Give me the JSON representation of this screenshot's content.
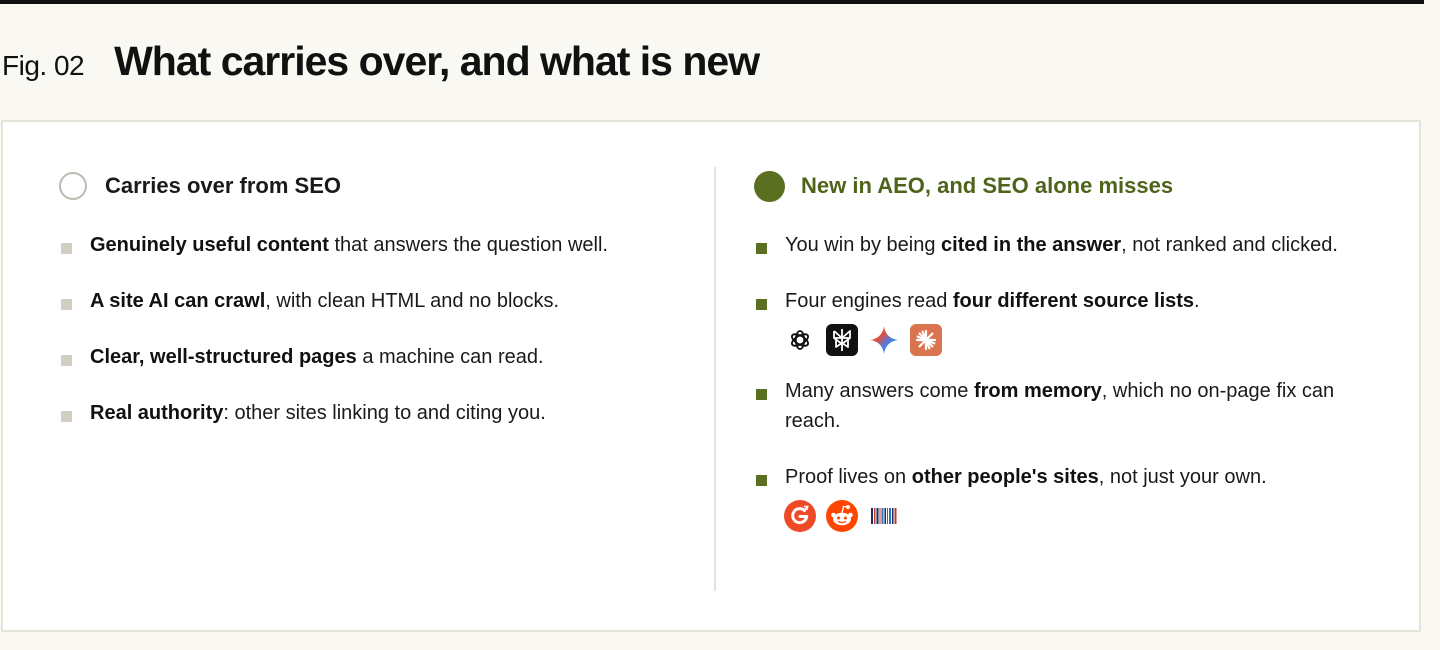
{
  "figure": {
    "label": "Fig. 02",
    "title": "What carries over, and what is new"
  },
  "left": {
    "title": "Carries over from SEO",
    "items": [
      {
        "strong": "Genuinely useful content",
        "rest": " that answers the question well."
      },
      {
        "strong": "A site AI can crawl",
        "rest": ", with clean HTML and no blocks."
      },
      {
        "strong": "Clear, well-structured pages",
        "rest": " a machine can read."
      },
      {
        "strong": "Real authority",
        "rest": ": other sites linking to and citing you."
      }
    ]
  },
  "right": {
    "title": "New in AEO, and SEO alone misses",
    "items": [
      {
        "pre": "You win by being ",
        "strong": "cited in the answer",
        "post": ", not ranked and clicked."
      },
      {
        "pre": "Four engines read ",
        "strong": "four different source lists",
        "post": ".",
        "icons": [
          "openai-icon",
          "perplexity-icon",
          "gemini-icon",
          "claude-icon"
        ]
      },
      {
        "pre": "Many answers come ",
        "strong": "from memory",
        "post": ", which no on-page fix can reach."
      },
      {
        "pre": "Proof lives on ",
        "strong": "other people's sites",
        "post": ", not just your own.",
        "icons": [
          "g2-icon",
          "reddit-icon",
          "wikipedia-barcode-icon"
        ]
      }
    ]
  },
  "colors": {
    "accent_green": "#5a6f1f",
    "heading_green": "#4f641b",
    "bullet_grey": "#d3cec2",
    "background": "#faf8f3",
    "card_border": "#e6e3da"
  }
}
